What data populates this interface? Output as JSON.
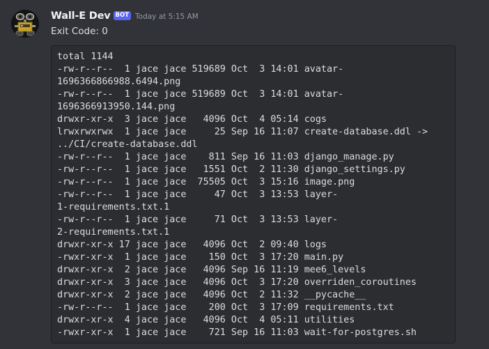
{
  "author": {
    "name": "Wall-E Dev",
    "bot_tag": "BOT",
    "timestamp": "Today at 5:15 AM",
    "avatar": "robot-avatar-icon"
  },
  "message": {
    "text": "Exit Code: 0"
  },
  "code_lines": [
    "total 1144",
    "-rw-r--r--  1 jace jace 519689 Oct  3 14:01 avatar-",
    "1696366866988.6494.png",
    "-rw-r--r--  1 jace jace 519689 Oct  3 14:01 avatar-",
    "1696366913950.144.png",
    "drwxr-xr-x  3 jace jace   4096 Oct  4 05:14 cogs",
    "lrwxrwxrwx  1 jace jace     25 Sep 16 11:07 create-database.ddl ->",
    "../CI/create-database.ddl",
    "-rw-r--r--  1 jace jace    811 Sep 16 11:03 django_manage.py",
    "-rw-r--r--  1 jace jace   1551 Oct  2 11:30 django_settings.py",
    "-rw-r--r--  1 jace jace  75505 Oct  3 15:16 image.png",
    "-rw-r--r--  1 jace jace     47 Oct  3 13:53 layer-",
    "1-requirements.txt.1",
    "-rw-r--r--  1 jace jace     71 Oct  3 13:53 layer-",
    "2-requirements.txt.1",
    "drwxr-xr-x 17 jace jace   4096 Oct  2 09:40 logs",
    "-rwxr-xr-x  1 jace jace    150 Oct  3 17:20 main.py",
    "drwxr-xr-x  2 jace jace   4096 Sep 16 11:19 mee6_levels",
    "drwxr-xr-x  3 jace jace   4096 Oct  3 17:20 overriden_coroutines",
    "drwxr-xr-x  2 jace jace   4096 Oct  2 11:32 __pycache__",
    "-rw-r--r--  1 jace jace    200 Oct  3 17:09 requirements.txt",
    "drwxr-xr-x  4 jace jace   4096 Oct  4 05:11 utilities",
    "-rwxr-xr-x  1 jace jace    721 Sep 16 11:03 wait-for-postgres.sh"
  ],
  "colors": {
    "background": "#313338",
    "code_background": "#2b2d31",
    "bot_tag": "#5865f2",
    "username": "#f2f3f5",
    "timestamp": "#949ba4",
    "text": "#dbdee1"
  }
}
